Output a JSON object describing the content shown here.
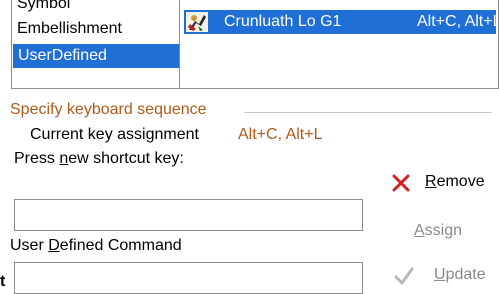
{
  "categories": {
    "items": [
      {
        "label": "Symbol",
        "selected": false
      },
      {
        "label": "Embellishment",
        "selected": false
      },
      {
        "label": "UserDefined",
        "selected": true
      }
    ]
  },
  "assignment": {
    "icon": "piper-icon",
    "name": "Crunluath Lo G1",
    "keys": "Alt+C, Alt+L"
  },
  "group": {
    "title": "Specify keyboard sequence"
  },
  "current": {
    "label": "Current key assignment",
    "value": "Alt+C, Alt+L"
  },
  "new_key": {
    "label_pre": "Press ",
    "label_u": "n",
    "label_post": "ew shortcut key:",
    "value": ""
  },
  "buttons": {
    "remove_u": "R",
    "remove_rest": "emove",
    "remove_icon": "red-x-icon",
    "assign_u": "A",
    "assign_rest": "ssign",
    "update_u": "U",
    "update_rest": "pdate",
    "update_icon": "checkmark-icon"
  },
  "command": {
    "label_pre": "User ",
    "label_u": "D",
    "label_post": "efined Command",
    "value": ""
  },
  "stray": "t",
  "colors": {
    "selection": "#1f6fd6",
    "accent": "#b05a1a",
    "disabled": "#8a8a8a",
    "remove_x": "#d42020"
  }
}
